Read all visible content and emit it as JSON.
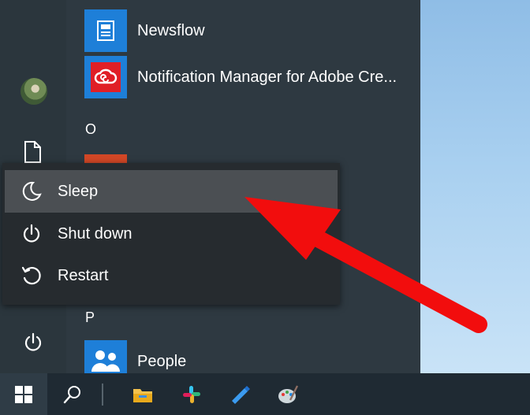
{
  "start_menu": {
    "apps": [
      {
        "label": "Newsflow",
        "icon": "newsflow-icon",
        "tile_color": "#1e7fd8"
      },
      {
        "label": "Notification Manager for Adobe Cre...",
        "icon": "adobe-creative-cloud-icon",
        "tile_color": "#1e7fd8"
      },
      {
        "label": "People",
        "icon": "people-icon",
        "tile_color": "#1e7fd8"
      }
    ],
    "group_letters": [
      "O",
      "P"
    ]
  },
  "left_rail": {
    "icons": [
      "user-avatar",
      "document-icon",
      "power-icon"
    ]
  },
  "power_menu": {
    "items": [
      {
        "label": "Sleep",
        "icon": "moon-icon",
        "highlighted": true
      },
      {
        "label": "Shut down",
        "icon": "power-icon",
        "highlighted": false
      },
      {
        "label": "Restart",
        "icon": "restart-icon",
        "highlighted": false
      }
    ]
  },
  "taskbar": {
    "icons": [
      "windows-start-icon",
      "search-icon",
      "file-explorer-icon",
      "slack-icon",
      "pen-app-icon",
      "paint-icon"
    ]
  },
  "annotation": {
    "type": "arrow",
    "color": "#f20d0d",
    "points_to": "Sleep"
  }
}
